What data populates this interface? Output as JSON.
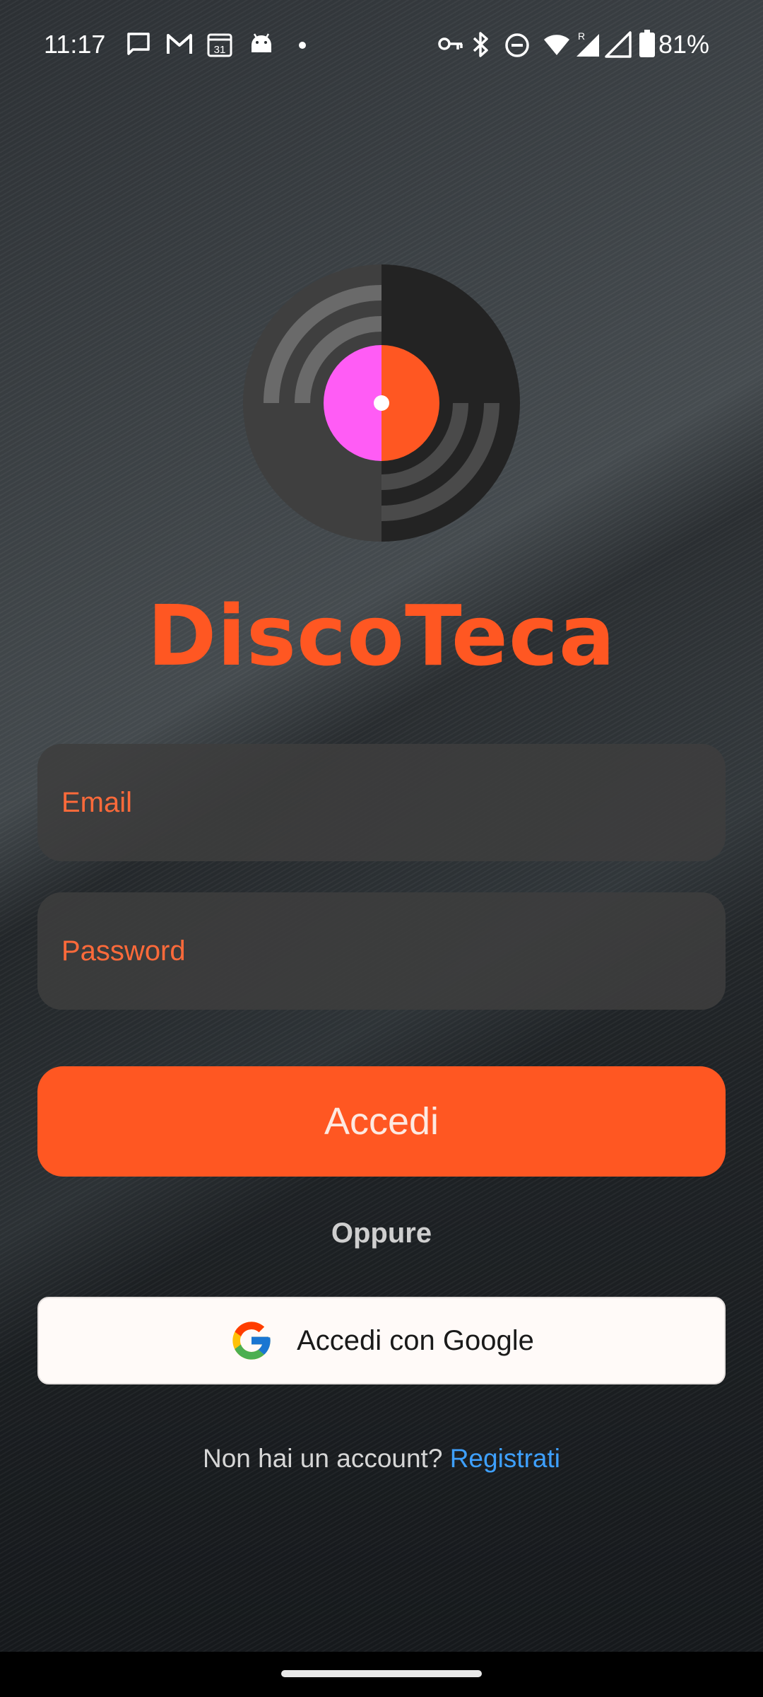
{
  "status_bar": {
    "time": "11:17",
    "battery": "81%",
    "left_icons": [
      "message-icon",
      "gmail-icon",
      "calendar-icon",
      "android-icon",
      "dot-icon"
    ],
    "right_icons": [
      "vpn-key-icon",
      "bluetooth-icon",
      "do-not-disturb-icon",
      "wifi-icon",
      "signal-roaming-icon",
      "signal-icon",
      "battery-icon"
    ],
    "calendar_day": "31"
  },
  "app": {
    "title": "DiscoTeca",
    "brand_color": "#ff5722"
  },
  "form": {
    "email_placeholder": "Email",
    "password_placeholder": "Password",
    "login_label": "Accedi",
    "or_label": "Oppure",
    "google_label": "Accedi con Google"
  },
  "signup": {
    "prompt": "Non hai un account?",
    "link": "Registrati"
  }
}
